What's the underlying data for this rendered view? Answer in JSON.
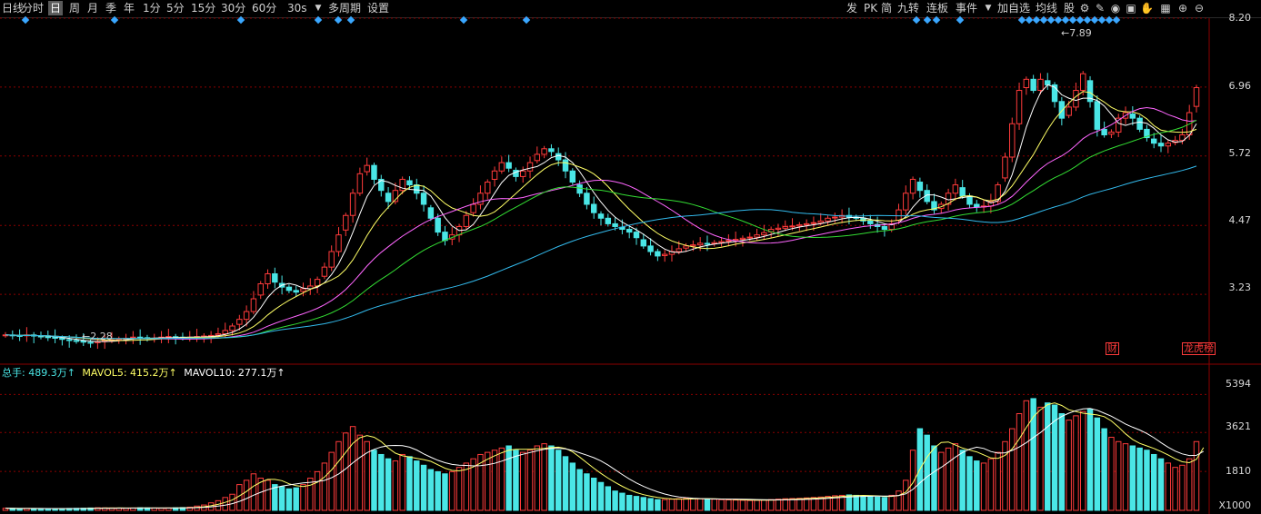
{
  "toolbar": {
    "left_items": [
      "日线",
      "分时",
      "日",
      "周",
      "月",
      "季",
      "年",
      "1分",
      "5分",
      "15分",
      "30分",
      "60分",
      "30s",
      "多周期",
      "设置"
    ],
    "active": "日",
    "dropdown_icon": "triangle-down-icon",
    "right_items": [
      "发",
      "PK",
      "简",
      "九转",
      "连板",
      "事件",
      "加自选",
      "均线",
      "股"
    ],
    "right_icons": [
      "settings-icon",
      "pen-icon",
      "eye-icon",
      "lock-icon",
      "hand-icon",
      "zoom-in-icon",
      "zoom-out-icon"
    ]
  },
  "price_axis": {
    "labels": [
      "8.20",
      "6.96",
      "5.72",
      "4.47",
      "3.23"
    ],
    "max": 8.2,
    "min": 1.99
  },
  "volume_axis": {
    "labels": [
      "5394",
      "3621",
      "1810",
      "X1000"
    ]
  },
  "annotations": {
    "high": "7.89",
    "low": "2.28",
    "finance_tag": "财",
    "list_tag": "龙虎榜"
  },
  "volume_legend": {
    "total": "总手: 489.3万↑",
    "mavol5": "MAVOL5: 415.2万↑",
    "mavol10": "MAVOL10: 277.1万↑"
  },
  "colors": {
    "up": "#ff3b3b",
    "down": "#4ae6e6",
    "ma5": "#ffffff",
    "ma10": "#ffff66",
    "ma20": "#ff66ff",
    "ma30": "#33dd33",
    "ma60": "#33bbee",
    "grid": "#8b0000"
  },
  "chart_data": {
    "type": "candlestick",
    "price_range": [
      1.99,
      8.2
    ],
    "volume_range": [
      0,
      6000
    ],
    "closes": [
      2.5,
      2.49,
      2.48,
      2.5,
      2.48,
      2.47,
      2.46,
      2.44,
      2.42,
      2.4,
      2.39,
      2.37,
      2.36,
      2.38,
      2.4,
      2.41,
      2.42,
      2.44,
      2.46,
      2.45,
      2.43,
      2.44,
      2.46,
      2.47,
      2.46,
      2.45,
      2.46,
      2.47,
      2.48,
      2.49,
      2.52,
      2.58,
      2.66,
      2.78,
      2.92,
      3.15,
      3.42,
      3.6,
      3.45,
      3.36,
      3.3,
      3.27,
      3.33,
      3.38,
      3.5,
      3.72,
      4.0,
      4.3,
      4.65,
      5.05,
      5.4,
      5.55,
      5.3,
      5.1,
      4.9,
      5.1,
      5.3,
      5.2,
      5.05,
      4.85,
      4.6,
      4.35,
      4.2,
      4.3,
      4.45,
      4.65,
      4.85,
      5.05,
      5.25,
      5.45,
      5.6,
      5.5,
      5.35,
      5.45,
      5.6,
      5.75,
      5.85,
      5.8,
      5.65,
      5.45,
      5.25,
      5.05,
      4.85,
      4.7,
      4.6,
      4.5,
      4.45,
      4.4,
      4.35,
      4.25,
      4.1,
      4.0,
      3.92,
      3.95,
      4.0,
      4.05,
      4.1,
      4.12,
      4.15,
      4.14,
      4.16,
      4.18,
      4.2,
      4.22,
      4.24,
      4.26,
      4.3,
      4.34,
      4.4,
      4.42,
      4.45,
      4.46,
      4.48,
      4.5,
      4.52,
      4.55,
      4.6,
      4.62,
      4.65,
      4.62,
      4.6,
      4.55,
      4.5,
      4.45,
      4.4,
      4.5,
      4.75,
      5.05,
      5.3,
      5.1,
      4.9,
      4.75,
      4.85,
      5.05,
      5.2,
      5.0,
      4.85,
      4.8,
      4.82,
      4.9,
      5.2,
      5.7,
      6.3,
      6.9,
      7.1,
      6.9,
      7.1,
      7.0,
      6.7,
      6.4,
      6.6,
      6.9,
      7.2,
      6.7,
      6.2,
      6.1,
      6.15,
      6.4,
      6.5,
      6.4,
      6.2,
      6.05,
      5.95,
      5.9,
      5.95,
      6.0,
      6.1,
      6.5,
      6.95
    ],
    "volumes_k": [
      100,
      90,
      80,
      90,
      85,
      80,
      80,
      75,
      85,
      90,
      95,
      100,
      110,
      120,
      115,
      110,
      105,
      100,
      110,
      120,
      115,
      110,
      100,
      110,
      120,
      130,
      150,
      200,
      250,
      350,
      450,
      600,
      750,
      1200,
      1400,
      1700,
      1500,
      1400,
      1200,
      1100,
      1000,
      1050,
      1200,
      1500,
      1800,
      2200,
      2700,
      3200,
      3600,
      3900,
      3500,
      3200,
      2800,
      2600,
      2400,
      2300,
      2600,
      2500,
      2300,
      2100,
      1900,
      1800,
      1700,
      1800,
      2000,
      2200,
      2400,
      2600,
      2700,
      2800,
      2900,
      3000,
      2800,
      2700,
      2800,
      3000,
      3100,
      3000,
      2800,
      2500,
      2200,
      1900,
      1700,
      1500,
      1300,
      1100,
      900,
      800,
      700,
      650,
      600,
      550,
      500,
      500,
      520,
      540,
      560,
      550,
      540,
      530,
      520,
      500,
      490,
      480,
      470,
      460,
      470,
      480,
      500,
      520,
      540,
      550,
      560,
      580,
      600,
      620,
      650,
      680,
      700,
      720,
      700,
      680,
      650,
      620,
      600,
      700,
      900,
      1400,
      2800,
      3800,
      3500,
      3000,
      2700,
      2900,
      3100,
      2800,
      2500,
      2300,
      2200,
      2400,
      2700,
      3200,
      3800,
      4500,
      5100,
      5200,
      4800,
      5000,
      4900,
      4500,
      4200,
      4400,
      4600,
      4700,
      4300,
      3800,
      3400,
      3200,
      3100,
      3000,
      2900,
      2800,
      2600,
      2400,
      2200,
      2000,
      2100,
      2400,
      3200,
      4893
    ]
  }
}
